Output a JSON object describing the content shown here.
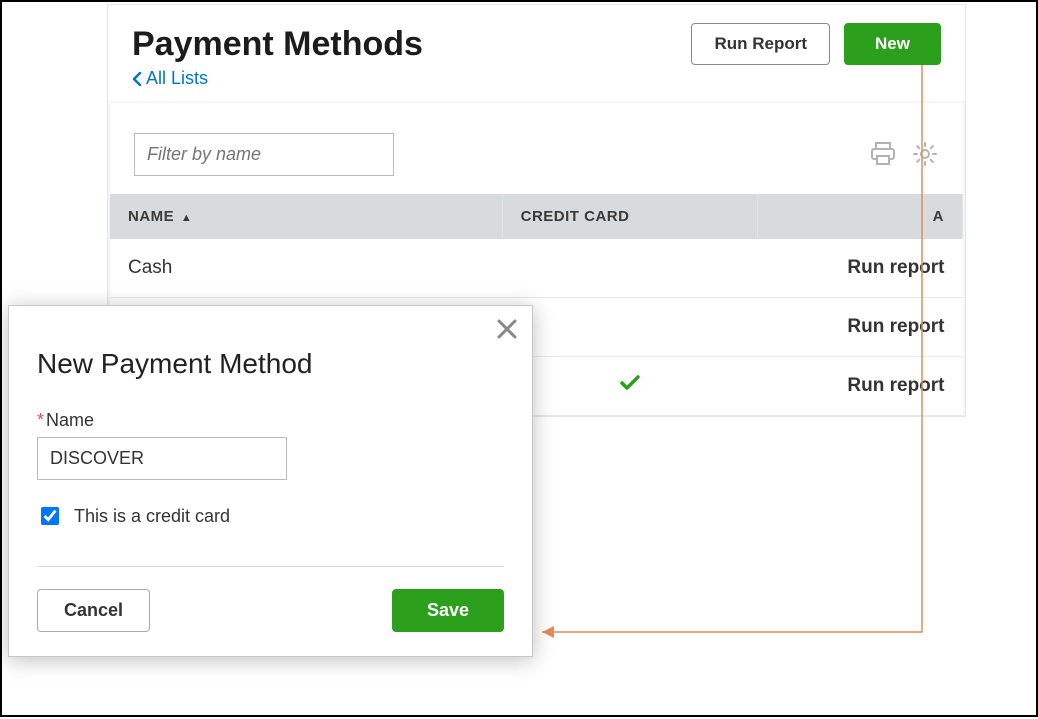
{
  "header": {
    "title": "Payment Methods",
    "run_report": "Run Report",
    "new": "New",
    "back_link": "All Lists"
  },
  "toolbar": {
    "filter_placeholder": "Filter by name"
  },
  "table": {
    "columns": {
      "name": "NAME",
      "credit_card": "CREDIT CARD",
      "action": "A"
    },
    "action_label": "Run report",
    "rows": [
      {
        "name": "Cash",
        "credit": false
      },
      {
        "name": "",
        "credit": false
      },
      {
        "name": "",
        "credit": true
      }
    ]
  },
  "modal": {
    "title": "New Payment Method",
    "name_label": "Name",
    "name_value": "DISCOVER",
    "credit_checkbox": "This is a credit card",
    "cancel": "Cancel",
    "save": "Save"
  }
}
